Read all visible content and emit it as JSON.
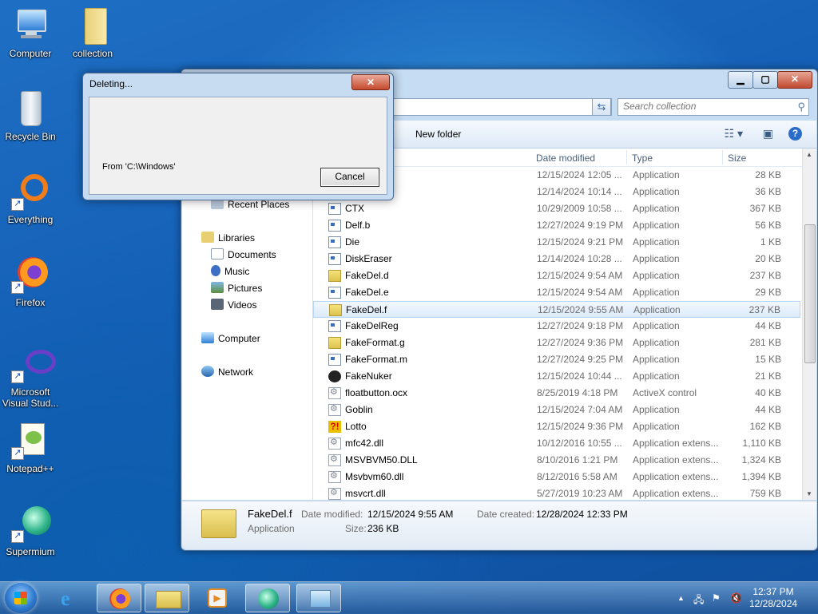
{
  "desktop": {
    "icons": [
      {
        "label": "Computer"
      },
      {
        "label": "collection"
      },
      {
        "label": "Recycle Bin"
      },
      {
        "label": "Everything"
      },
      {
        "label": "Firefox"
      },
      {
        "label": "Microsoft Visual Stud..."
      },
      {
        "label": "Notepad++"
      },
      {
        "label": "Supermium"
      }
    ]
  },
  "explorer": {
    "search_placeholder": "Search collection",
    "toolbar": {
      "new_folder": "New folder"
    },
    "nav": {
      "recent_places": "Recent Places",
      "libraries": "Libraries",
      "documents": "Documents",
      "music": "Music",
      "pictures": "Pictures",
      "videos": "Videos",
      "computer": "Computer",
      "network": "Network"
    },
    "columns": {
      "date": "Date modified",
      "type": "Type",
      "size": "Size"
    },
    "files": [
      {
        "name": "",
        "date": "12/15/2024 12:05 ...",
        "type": "Application",
        "size": "28 KB",
        "icon": "app-icon"
      },
      {
        "name": "",
        "date": "12/14/2024 10:14 ...",
        "type": "Application",
        "size": "36 KB",
        "icon": "app-icon"
      },
      {
        "name": "CTX",
        "date": "10/29/2009 10:58 ...",
        "type": "Application",
        "size": "367 KB",
        "icon": "app-icon"
      },
      {
        "name": "Delf.b",
        "date": "12/27/2024 9:19 PM",
        "type": "Application",
        "size": "56 KB",
        "icon": "app-icon"
      },
      {
        "name": "Die",
        "date": "12/15/2024 9:21 PM",
        "type": "Application",
        "size": "1 KB",
        "icon": "app-icon"
      },
      {
        "name": "DiskEraser",
        "date": "12/14/2024 10:28 ...",
        "type": "Application",
        "size": "20 KB",
        "icon": "app-icon"
      },
      {
        "name": "FakeDel.d",
        "date": "12/15/2024 9:54 AM",
        "type": "Application",
        "size": "237 KB",
        "icon": "folder-icon"
      },
      {
        "name": "FakeDel.e",
        "date": "12/15/2024 9:54 AM",
        "type": "Application",
        "size": "29 KB",
        "icon": "app-icon"
      },
      {
        "name": "FakeDel.f",
        "date": "12/15/2024 9:55 AM",
        "type": "Application",
        "size": "237 KB",
        "icon": "folder-icon"
      },
      {
        "name": "FakeDelReg",
        "date": "12/27/2024 9:18 PM",
        "type": "Application",
        "size": "44 KB",
        "icon": "app-icon"
      },
      {
        "name": "FakeFormat.g",
        "date": "12/27/2024 9:36 PM",
        "type": "Application",
        "size": "281 KB",
        "icon": "folder-icon"
      },
      {
        "name": "FakeFormat.m",
        "date": "12/27/2024 9:25 PM",
        "type": "Application",
        "size": "15 KB",
        "icon": "app-icon"
      },
      {
        "name": "FakeNuker",
        "date": "12/15/2024 10:44 ...",
        "type": "Application",
        "size": "21 KB",
        "icon": "round-icon"
      },
      {
        "name": "floatbutton.ocx",
        "date": "8/25/2019 4:18 PM",
        "type": "ActiveX control",
        "size": "40 KB",
        "icon": "dll-icon"
      },
      {
        "name": "Goblin",
        "date": "12/15/2024 7:04 AM",
        "type": "Application",
        "size": "44 KB",
        "icon": "dll-icon"
      },
      {
        "name": "Lotto",
        "date": "12/15/2024 9:36 PM",
        "type": "Application",
        "size": "162 KB",
        "icon": "warning-icon"
      },
      {
        "name": "mfc42.dll",
        "date": "10/12/2016 10:55 ...",
        "type": "Application extens...",
        "size": "1,110 KB",
        "icon": "dll-icon"
      },
      {
        "name": "MSVBVM50.DLL",
        "date": "8/10/2016 1:21 PM",
        "type": "Application extens...",
        "size": "1,324 KB",
        "icon": "dll-icon"
      },
      {
        "name": "Msvbvm60.dll",
        "date": "8/12/2016 5:58 AM",
        "type": "Application extens...",
        "size": "1,394 KB",
        "icon": "dll-icon"
      },
      {
        "name": "msvcrt.dll",
        "date": "5/27/2019 10:23 AM",
        "type": "Application extens...",
        "size": "759 KB",
        "icon": "dll-icon"
      }
    ],
    "selected_index": 8,
    "details": {
      "name": "FakeDel.f",
      "type": "Application",
      "date_modified_label": "Date modified:",
      "date_modified": "12/15/2024 9:55 AM",
      "size_label": "Size:",
      "size": "236 KB",
      "date_created_label": "Date created:",
      "date_created": "12/28/2024 12:33 PM"
    }
  },
  "dialog": {
    "title": "Deleting...",
    "from": "From 'C:\\Windows'",
    "cancel": "Cancel"
  },
  "taskbar": {
    "time": "12:37 PM",
    "date": "12/28/2024"
  }
}
